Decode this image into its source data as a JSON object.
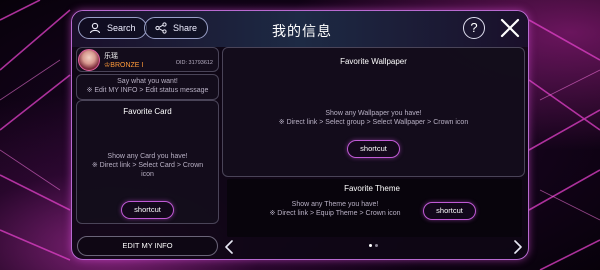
{
  "header": {
    "search_label": "Search",
    "share_label": "Share",
    "title": "我的信息",
    "help_label": "?"
  },
  "profile": {
    "name": "乐瑶",
    "rank": "BRONZE I",
    "oid": "OID: 31793612"
  },
  "status": {
    "line1": "Say what you want!",
    "line2": "※ Edit MY INFO > Edit status message"
  },
  "favorite_card": {
    "title": "Favorite Card",
    "hint_line1": "Show any Card you have!",
    "hint_line2": "※ Direct link > Select Card > Crown",
    "hint_line3": "icon",
    "shortcut_label": "shortcut"
  },
  "favorite_wallpaper": {
    "title": "Favorite Wallpaper",
    "hint_line1": "Show any Wallpaper you have!",
    "hint_line2": "※ Direct link > Select group > Select Wallpaper > Crown icon",
    "shortcut_label": "shortcut"
  },
  "favorite_theme": {
    "title": "Favorite Theme",
    "hint_line1": "Show any Theme you have!",
    "hint_line2": "※ Direct link > Equip Theme > Crown icon",
    "shortcut_label": "shortcut"
  },
  "footer": {
    "edit_label": "EDIT MY INFO",
    "page_index": 1,
    "page_count": 2
  },
  "colors": {
    "accent": "#c15ad6",
    "rank": "#ff9a3a",
    "panel_border": "#b86ad0"
  },
  "icons": [
    "search-icon",
    "share-icon",
    "help-icon",
    "close-icon",
    "rank-icon",
    "prev-arrow-icon",
    "next-arrow-icon"
  ]
}
